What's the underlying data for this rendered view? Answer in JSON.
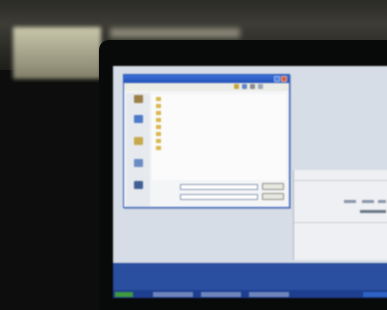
{
  "dialog": {
    "title": "",
    "look_in_label": "",
    "places": [
      {
        "label": "",
        "icon": "recent-documents-icon"
      },
      {
        "label": "",
        "icon": "desktop-icon"
      },
      {
        "label": "",
        "icon": "my-documents-icon"
      },
      {
        "label": "",
        "icon": "my-computer-icon"
      },
      {
        "label": "",
        "icon": "network-places-icon"
      }
    ],
    "files": [
      "",
      "",
      "",
      "",
      "",
      "",
      "",
      ""
    ],
    "filename_label": "",
    "filename_value": "",
    "filetype_label": "",
    "filetype_value": "",
    "open_button": "",
    "cancel_button": ""
  },
  "colors": {
    "titlebar": "#2352b8",
    "desktop": "#2a4ea0",
    "window_bg": "#f4f5f6"
  }
}
